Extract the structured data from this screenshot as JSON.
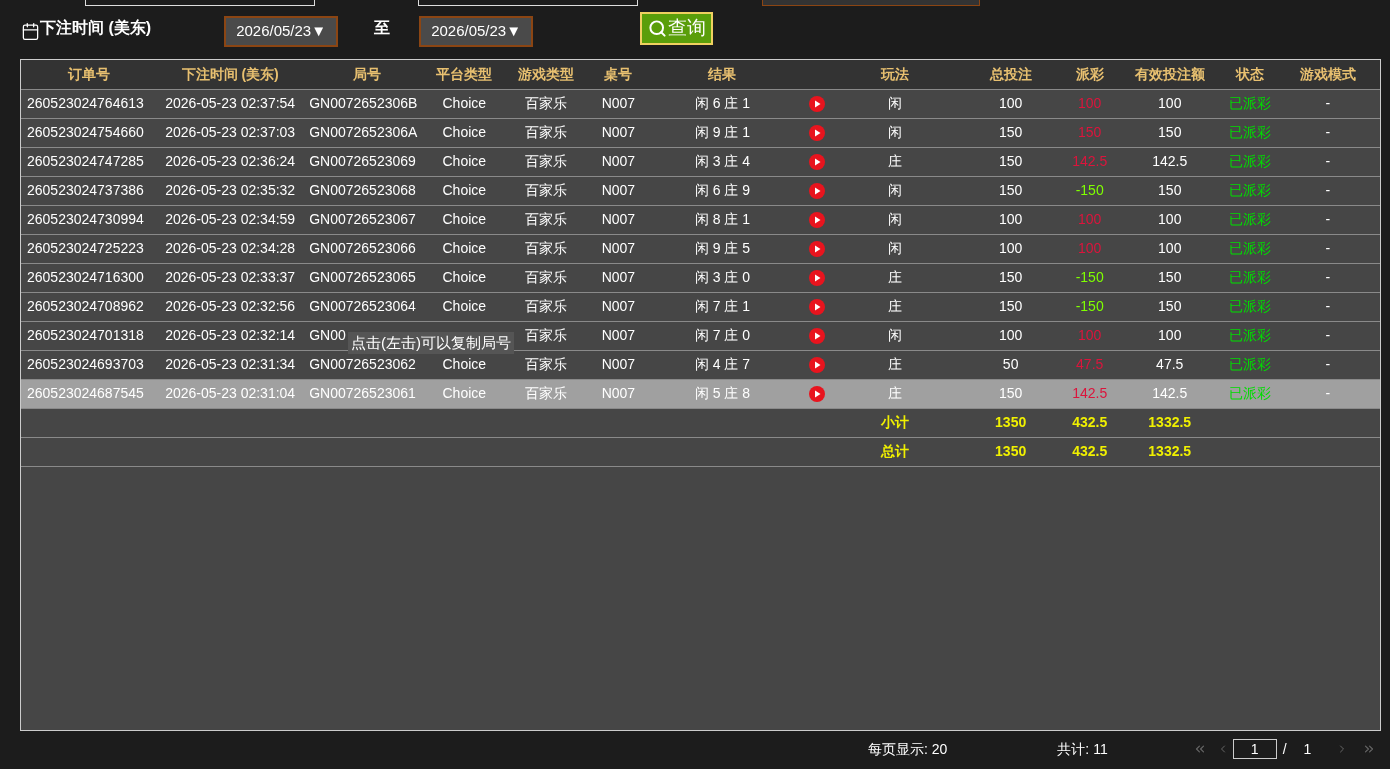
{
  "filter": {
    "label": "下注时间 (美东)",
    "from": "2026/05/23▼",
    "separator": "至",
    "to": "2026/05/23▼",
    "query_button": "查询"
  },
  "table": {
    "columns": [
      "订单号",
      "下注时间 (美东)",
      "局号",
      "平台类型",
      "游戏类型",
      "桌号",
      "结果",
      "",
      "玩法",
      "总投注",
      "派彩",
      "有效投注额",
      "状态",
      "游戏模式"
    ],
    "rows": [
      {
        "order": "260523024764613",
        "time": "2026-05-23 02:37:54",
        "round": "GN0072652306B",
        "platform": "Choice",
        "game": "百家乐",
        "table": "N007",
        "result": "闲 6 庄 1",
        "play": "闲",
        "bet": "100",
        "payout": {
          "text": "100",
          "color": "#dc143c"
        },
        "valid": "100",
        "status": {
          "text": "已派彩",
          "color": "#00dd00"
        },
        "mode": "-",
        "selected": false
      },
      {
        "order": "260523024754660",
        "time": "2026-05-23 02:37:03",
        "round": "GN0072652306A",
        "platform": "Choice",
        "game": "百家乐",
        "table": "N007",
        "result": "闲 9 庄 1",
        "play": "闲",
        "bet": "150",
        "payout": {
          "text": "150",
          "color": "#dc143c"
        },
        "valid": "150",
        "status": {
          "text": "已派彩",
          "color": "#00dd00"
        },
        "mode": "-",
        "selected": false
      },
      {
        "order": "260523024747285",
        "time": "2026-05-23 02:36:24",
        "round": "GN00726523069",
        "platform": "Choice",
        "game": "百家乐",
        "table": "N007",
        "result": "闲 3 庄 4",
        "play": "庄",
        "bet": "150",
        "payout": {
          "text": "142.5",
          "color": "#dc143c"
        },
        "valid": "142.5",
        "status": {
          "text": "已派彩",
          "color": "#00dd00"
        },
        "mode": "-",
        "selected": false
      },
      {
        "order": "260523024737386",
        "time": "2026-05-23 02:35:32",
        "round": "GN00726523068",
        "platform": "Choice",
        "game": "百家乐",
        "table": "N007",
        "result": "闲 6 庄 9",
        "play": "闲",
        "bet": "150",
        "payout": {
          "text": "-150",
          "color": "#7fff00"
        },
        "valid": "150",
        "status": {
          "text": "已派彩",
          "color": "#00dd00"
        },
        "mode": "-",
        "selected": false
      },
      {
        "order": "260523024730994",
        "time": "2026-05-23 02:34:59",
        "round": "GN00726523067",
        "platform": "Choice",
        "game": "百家乐",
        "table": "N007",
        "result": "闲 8 庄 1",
        "play": "闲",
        "bet": "100",
        "payout": {
          "text": "100",
          "color": "#dc143c"
        },
        "valid": "100",
        "status": {
          "text": "已派彩",
          "color": "#00dd00"
        },
        "mode": "-",
        "selected": false
      },
      {
        "order": "260523024725223",
        "time": "2026-05-23 02:34:28",
        "round": "GN00726523066",
        "platform": "Choice",
        "game": "百家乐",
        "table": "N007",
        "result": "闲 9 庄 5",
        "play": "闲",
        "bet": "100",
        "payout": {
          "text": "100",
          "color": "#dc143c"
        },
        "valid": "100",
        "status": {
          "text": "已派彩",
          "color": "#00dd00"
        },
        "mode": "-",
        "selected": false
      },
      {
        "order": "260523024716300",
        "time": "2026-05-23 02:33:37",
        "round": "GN00726523065",
        "platform": "Choice",
        "game": "百家乐",
        "table": "N007",
        "result": "闲 3 庄 0",
        "play": "庄",
        "bet": "150",
        "payout": {
          "text": "-150",
          "color": "#7fff00"
        },
        "valid": "150",
        "status": {
          "text": "已派彩",
          "color": "#00dd00"
        },
        "mode": "-",
        "selected": false
      },
      {
        "order": "260523024708962",
        "time": "2026-05-23 02:32:56",
        "round": "GN00726523064",
        "platform": "Choice",
        "game": "百家乐",
        "table": "N007",
        "result": "闲 7 庄 1",
        "play": "庄",
        "bet": "150",
        "payout": {
          "text": "-150",
          "color": "#7fff00"
        },
        "valid": "150",
        "status": {
          "text": "已派彩",
          "color": "#00dd00"
        },
        "mode": "-",
        "selected": false
      },
      {
        "order": "260523024701318",
        "time": "2026-05-23 02:32:14",
        "round": "GN00",
        "game": "百家乐",
        "table": "N007",
        "result": "闲 7 庄 0",
        "play": "闲",
        "bet": "100",
        "payout": {
          "text": "100",
          "color": "#dc143c"
        },
        "valid": "100",
        "status": {
          "text": "已派彩",
          "color": "#00dd00"
        },
        "mode": "-",
        "selected": false
      },
      {
        "order": "260523024693703",
        "time": "2026-05-23 02:31:34",
        "round": "GN00726523062",
        "platform": "Choice",
        "game": "百家乐",
        "table": "N007",
        "result": "闲 4 庄 7",
        "play": "庄",
        "bet": "50",
        "payout": {
          "text": "47.5",
          "color": "#dc143c"
        },
        "valid": "47.5",
        "status": {
          "text": "已派彩",
          "color": "#00dd00"
        },
        "mode": "-",
        "selected": false
      },
      {
        "order": "260523024687545",
        "time": "2026-05-23 02:31:04",
        "round": "GN00726523061",
        "platform": "Choice",
        "game": "百家乐",
        "table": "N007",
        "result": "闲 5 庄 8",
        "play": "庄",
        "bet": "150",
        "payout": {
          "text": "142.5",
          "color": "#dc143c"
        },
        "valid": "142.5",
        "status": {
          "text": "已派彩",
          "color": "#00dd00"
        },
        "mode": "-",
        "selected": true
      }
    ],
    "totals": [
      {
        "label": "小计",
        "bet": "1350",
        "payout": "432.5",
        "valid": "1332.5"
      },
      {
        "label": "总计",
        "bet": "1350",
        "payout": "432.5",
        "valid": "1332.5"
      }
    ]
  },
  "tooltip": "点击(左击)可以复制局号",
  "footer": {
    "page_size": "每页显示: 20",
    "total": "共计: 11",
    "page": "1",
    "separator": "/",
    "pages": "1"
  }
}
